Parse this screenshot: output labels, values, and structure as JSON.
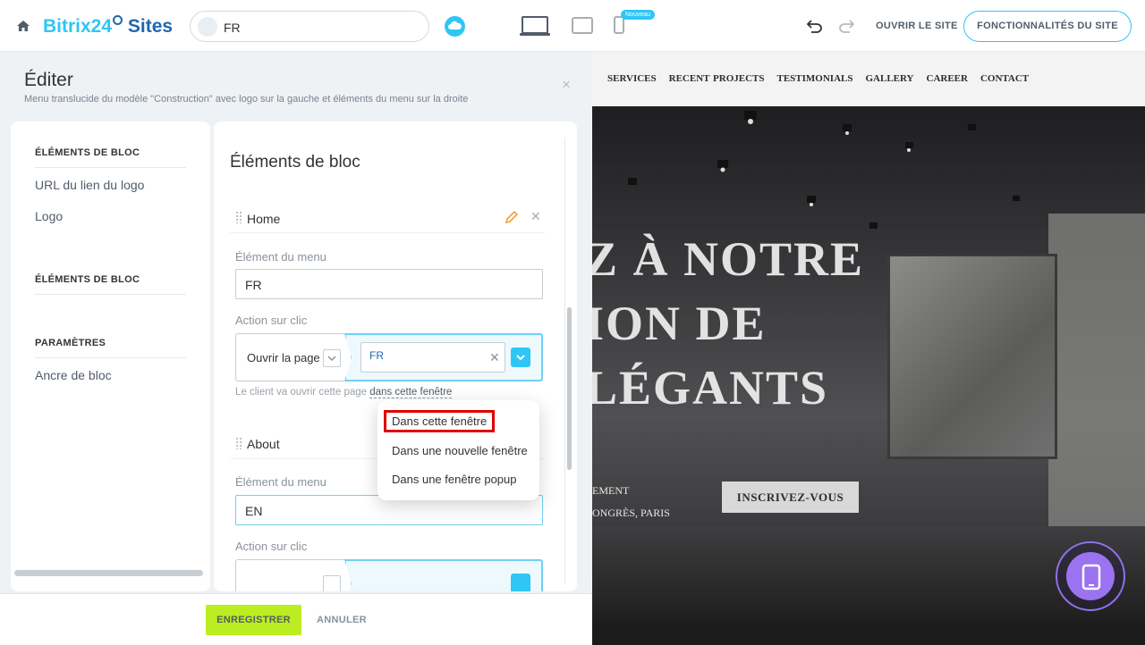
{
  "topbar": {
    "logo_part1": "Bitrix24",
    "logo_part2": "Sites",
    "site_name": "FR",
    "new_badge": "Nouveau",
    "open_site": "OUVRIR LE SITE",
    "features": "FONCTIONNALITÉS DU SITE"
  },
  "editor": {
    "title": "Éditer",
    "subtitle": "Menu translucide du modèle \"Construction\" avec logo sur la gauche et éléments du menu sur la droite",
    "close": "×",
    "nav": {
      "section1": "ÉLÉMENTS DE BLOC",
      "item1": "URL du lien du logo",
      "item2": "Logo",
      "section2": "ÉLÉMENTS DE BLOC",
      "section3": "PARAMÈTRES",
      "item3": "Ancre de bloc"
    },
    "form": {
      "title": "Éléments de bloc",
      "items": [
        {
          "name": "Home",
          "menu_label": "Élément du menu",
          "menu_value": "FR",
          "action_label": "Action sur clic",
          "action_type": "Ouvrir la page",
          "action_target": "FR"
        },
        {
          "name": "About",
          "menu_label": "Élément du menu",
          "menu_value": "EN",
          "action_label": "Action sur clic"
        }
      ],
      "hint_prefix": "Le client va ouvrir cette page",
      "hint_link": "dans cette fenêtre"
    },
    "popup": {
      "options": [
        "Dans cette fenêtre",
        "Dans une nouvelle fenêtre",
        "Dans une fenêtre popup"
      ],
      "selected_index": 0
    },
    "buttons": {
      "save": "ENREGISTRER",
      "cancel": "ANNULER"
    }
  },
  "preview": {
    "nav_items": [
      "SERVICES",
      "RECENT PROJECTS",
      "TESTIMONIALS",
      "GALLERY",
      "CAREER",
      "CONTACT"
    ],
    "hero_lines": [
      "Z À NOTRE",
      "ION DE",
      "LÉGANTS"
    ],
    "sub_line1": "EMENT",
    "sub_line2": "ONGRÈS, PARIS",
    "cta": "INSCRIVEZ-VOUS"
  },
  "colors": {
    "accent": "#2fc6f6",
    "save": "#bbed21",
    "highlight": "#e00000",
    "fab": "#9b73f0"
  }
}
